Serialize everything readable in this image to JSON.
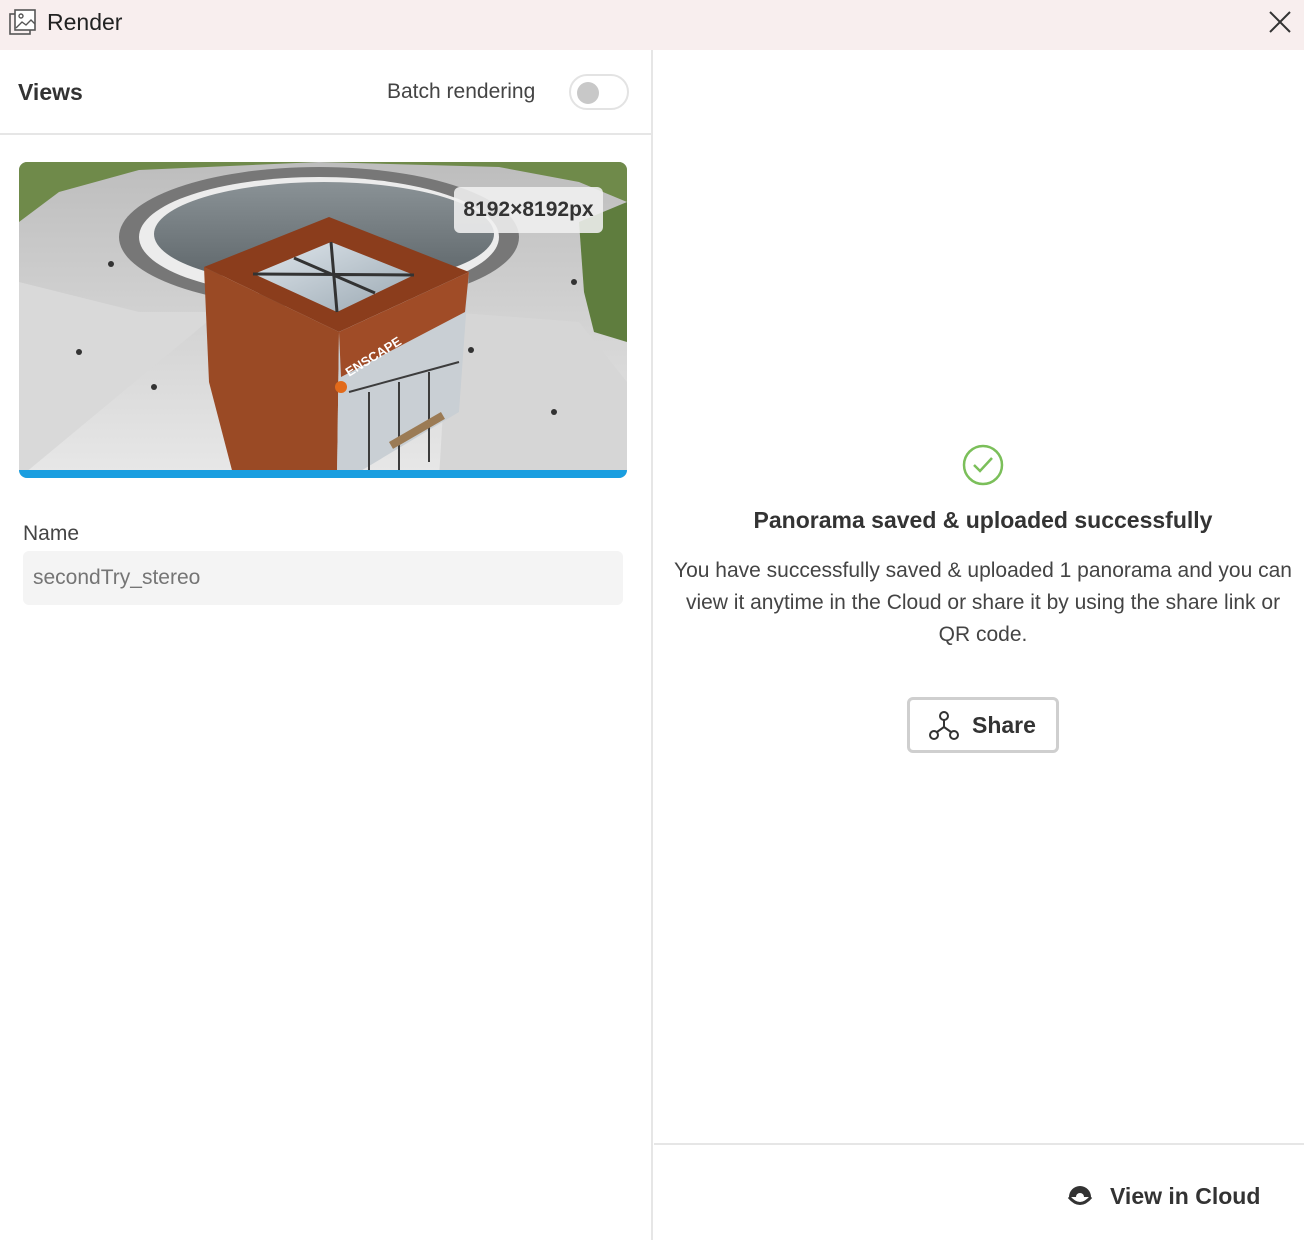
{
  "window": {
    "title": "Render",
    "app_icon": "images-icon",
    "close_icon": "close-icon"
  },
  "left_panel": {
    "views_title": "Views",
    "batch_rendering_label": "Batch rendering",
    "batch_rendering_on": false,
    "thumbnail": {
      "resolution_badge": "8192×8192px",
      "logo_text": "ENSCAPE"
    },
    "name_label": "Name",
    "name_placeholder": "secondTry_stereo"
  },
  "right_panel": {
    "success_icon": "check-circle-icon",
    "success_title": "Panorama saved & uploaded successfully",
    "success_message": "You have successfully saved & uploaded 1 panorama and you can view it anytime in the Cloud or share it by using the share link or QR code.",
    "share_button": {
      "label": "Share",
      "icon": "share-icon"
    },
    "view_in_cloud_button": {
      "label": "View in Cloud",
      "icon": "cloud-view-icon"
    }
  },
  "colors": {
    "titlebar_bg": "#f8eeee",
    "progress_bar": "#1a9ee0",
    "success_green": "#7bbf5a",
    "cube_brown": "#9a4a25"
  }
}
